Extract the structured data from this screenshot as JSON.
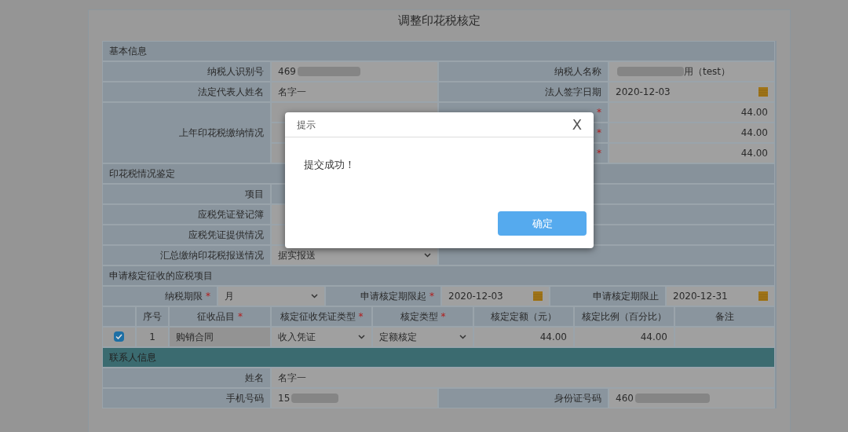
{
  "title": "调整印花税核定",
  "basic": {
    "header": "基本信息",
    "taxpayer_id": {
      "label": "纳税人识别号",
      "value": "469"
    },
    "taxpayer_name": {
      "label": "纳税人名称",
      "value": "用（test）"
    },
    "legal_rep": {
      "label": "法定代表人姓名",
      "value": "名字一"
    },
    "sign_date": {
      "label": "法人签字日期",
      "value": "2020-12-03"
    },
    "last_year": {
      "label": "上年印花税缴纳情况",
      "items": [
        {
          "mark": "*",
          "value": "44.00"
        },
        {
          "mark": "*",
          "value": "44.00"
        },
        {
          "mark": "*",
          "value": "44.00"
        }
      ]
    }
  },
  "assessment": {
    "header": "印花税情况鉴定",
    "rows": [
      {
        "kind": "text",
        "label": "项目"
      },
      {
        "kind": "select",
        "label": "应税凭证登记簿"
      },
      {
        "kind": "select",
        "label": "应税凭证提供情况"
      },
      {
        "kind": "select",
        "label": "汇总缴纳印花税报送情况",
        "value": "据实报送"
      }
    ]
  },
  "apply": {
    "header": "申请核定征收的应税项目",
    "period": {
      "label": "纳税期限",
      "mark": "*",
      "value": "月"
    },
    "start": {
      "label": "申请核定期限起",
      "mark": "*",
      "value": "2020-12-03"
    },
    "end": {
      "label": "申请核定期限止",
      "value": "2020-12-31"
    },
    "columns": [
      {
        "label": "序号"
      },
      {
        "label": "征收品目",
        "mark": "*"
      },
      {
        "label": "核定征收凭证类型",
        "mark": "*"
      },
      {
        "label": "核定类型",
        "mark": "*"
      },
      {
        "label": "核定定额（元）"
      },
      {
        "label": "核定比例（百分比）"
      },
      {
        "label": "备注"
      }
    ],
    "rows": [
      {
        "checked": true,
        "no": "1",
        "item": "购销合同",
        "voucher_type": "收入凭证",
        "assess_type": "定额核定",
        "amount": "44.00",
        "ratio": "44.00"
      }
    ]
  },
  "contact": {
    "header": "联系人信息",
    "name": {
      "label": "姓名",
      "value": "名字一"
    },
    "phone": {
      "label": "手机号码",
      "value": "15"
    },
    "id_no": {
      "label": "身份证号码",
      "value": "460"
    }
  },
  "dialog": {
    "title": "提示",
    "close": "X",
    "message": "提交成功！",
    "button": "确定"
  }
}
